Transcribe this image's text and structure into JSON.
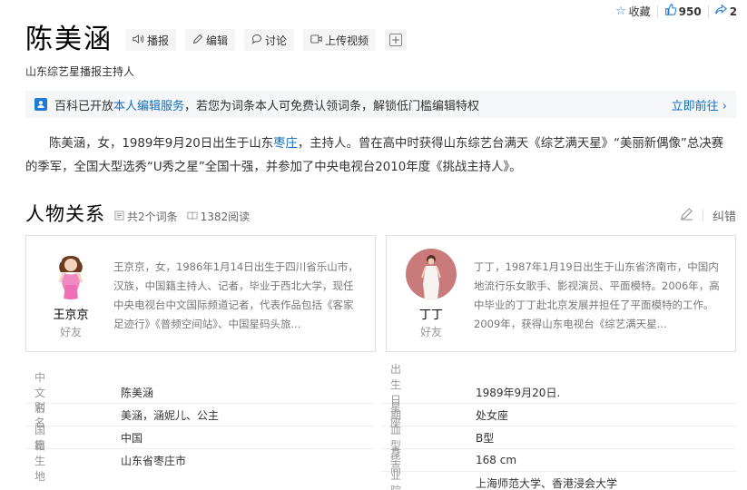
{
  "top_actions": {
    "favorite_label": "收藏",
    "like_count": "950",
    "share_count": "2"
  },
  "title": "陈美涵",
  "toolbar": {
    "broadcast": "播报",
    "edit": "编辑",
    "discuss": "讨论",
    "upload_video": "上传视频",
    "add": "+"
  },
  "subtitle": "山东综艺星播报主持人",
  "notice": {
    "text_before": "百科已开放",
    "link": "本人编辑服务",
    "text_after": "，若您为词条本人可免费认领词条，解锁低门槛编辑特权",
    "go": "立即前往 ›"
  },
  "summary": {
    "p1": "陈美涵，女，1989年9月20日出生于山东",
    "p1_link": "枣庄",
    "p2": "，主持人。曾在高中时获得山东综艺台满天《综艺满天星》“美丽新偶像”总决赛的季军，全国大型选秀“U秀之星”全国十强，并参加了中央电视台2010年度《挑战主持人》。"
  },
  "relations": {
    "title": "人物关系",
    "entries_count": "共2个词条",
    "reads": "1382阅读",
    "correct": "纠错",
    "people": [
      {
        "name": "王京京",
        "relation": "好友",
        "desc": "王京京，女，1986年1月14日出生于四川省乐山市，汉族，中国籍主持人、记者，毕业于西北大学，现任中央电视台中文国际频道记者，代表作品包括《客家足迹行》《普频空间站》、中国星码头旅..."
      },
      {
        "name": "丁丁",
        "relation": "好友",
        "desc": "丁丁，1987年1月19日出生于山东省济南市，中国内地流行乐女歌手、影视演员、平面模特。2006年，高中毕业的丁丁赴北京发展并担任了平面模特的工作。2009年，获得山东电视台《综艺满天星..."
      }
    ]
  },
  "info": {
    "left": [
      {
        "key": "中文名",
        "value": "陈美涵"
      },
      {
        "key": "别　名",
        "value": "美涵，涵妮儿、公主"
      },
      {
        "key": "国　籍",
        "value": "中国"
      },
      {
        "key": "出生地",
        "value": "山东省枣庄市"
      }
    ],
    "right": [
      {
        "key": "出生日期",
        "value": "1989年9月20日."
      },
      {
        "key": "星　座",
        "value": "处女座"
      },
      {
        "key": "血　型",
        "value": "B型"
      },
      {
        "key": "身　高",
        "value": "168 cm"
      },
      {
        "key": "毕业院校",
        "value": "上海师范大学、香港浸会大学"
      }
    ]
  }
}
